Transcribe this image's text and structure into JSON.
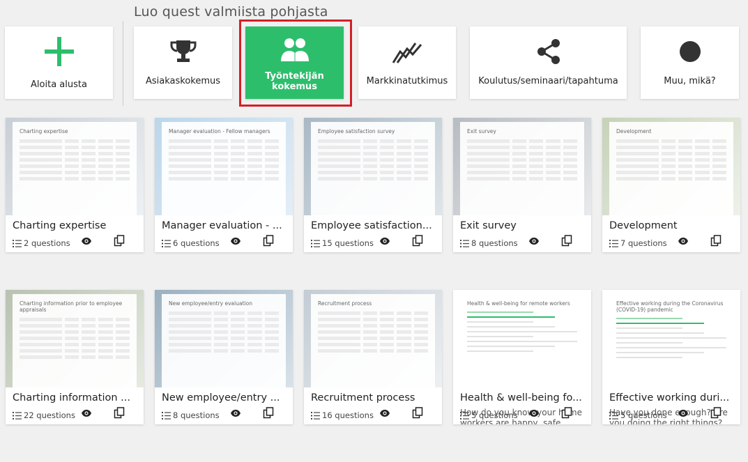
{
  "header": {
    "title": "Luo quest valmiista pohjasta"
  },
  "categories": [
    {
      "label": "Aloita alusta",
      "icon": "plus-icon",
      "selected": false
    },
    {
      "label": "Asiakaskokemus",
      "icon": "trophy-icon",
      "selected": false
    },
    {
      "label": "Työntekijän kokemus",
      "icon": "people-icon",
      "selected": true
    },
    {
      "label": "Markkinatutkimus",
      "icon": "trend-chart-icon",
      "selected": false
    },
    {
      "label": "Koulutus/seminaari/tapahtuma",
      "icon": "share-icon",
      "selected": false
    },
    {
      "label": "Muu, mikä?",
      "icon": "circle-icon",
      "selected": false
    }
  ],
  "templates": [
    {
      "title": "Charting expertise",
      "preview_title": "Charting expertise",
      "questions": "2 questions",
      "description": ""
    },
    {
      "title": "Manager evaluation - ...",
      "preview_title": "Manager evaluation - Fellow managers",
      "questions": "6 questions",
      "description": ""
    },
    {
      "title": "Employee satisfaction...",
      "preview_title": "Employee satisfaction survey",
      "questions": "15 questions",
      "description": ""
    },
    {
      "title": "Exit survey",
      "preview_title": "Exit survey",
      "questions": "8 questions",
      "description": ""
    },
    {
      "title": "Development",
      "preview_title": "Development",
      "questions": "7 questions",
      "description": ""
    },
    {
      "title": "Charting information ...",
      "preview_title": "Charting information prior to employee appraisals",
      "questions": "22 questions",
      "description": ""
    },
    {
      "title": "New employee/entry ...",
      "preview_title": "New employee/entry evaluation",
      "questions": "8 questions",
      "description": ""
    },
    {
      "title": "Recruitment process",
      "preview_title": "Recruitment process",
      "questions": "16 questions",
      "description": ""
    },
    {
      "title": "Health & well-being fo...",
      "preview_title": "Health & well-being for remote workers",
      "questions": "5 questions",
      "description": "How do you know your home workers are happy, safe and..."
    },
    {
      "title": "Effective working duri...",
      "preview_title": "Effective working during the Coronavirus (COVID-19) pandemic",
      "questions": "5 questions",
      "description": "Have you done enough? Are you doing the right things?..."
    }
  ],
  "colors": {
    "accent": "#2dbe6c",
    "highlight": "#d41f26"
  }
}
